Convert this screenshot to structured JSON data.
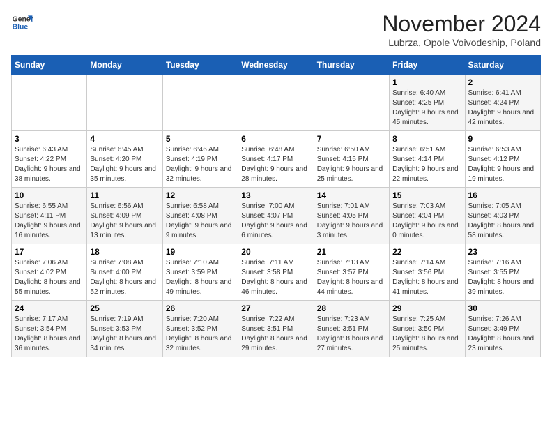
{
  "logo": {
    "general": "General",
    "blue": "Blue"
  },
  "title": "November 2024",
  "subtitle": "Lubrza, Opole Voivodeship, Poland",
  "weekdays": [
    "Sunday",
    "Monday",
    "Tuesday",
    "Wednesday",
    "Thursday",
    "Friday",
    "Saturday"
  ],
  "weeks": [
    [
      {
        "day": "",
        "info": ""
      },
      {
        "day": "",
        "info": ""
      },
      {
        "day": "",
        "info": ""
      },
      {
        "day": "",
        "info": ""
      },
      {
        "day": "",
        "info": ""
      },
      {
        "day": "1",
        "info": "Sunrise: 6:40 AM\nSunset: 4:25 PM\nDaylight: 9 hours and 45 minutes."
      },
      {
        "day": "2",
        "info": "Sunrise: 6:41 AM\nSunset: 4:24 PM\nDaylight: 9 hours and 42 minutes."
      }
    ],
    [
      {
        "day": "3",
        "info": "Sunrise: 6:43 AM\nSunset: 4:22 PM\nDaylight: 9 hours and 38 minutes."
      },
      {
        "day": "4",
        "info": "Sunrise: 6:45 AM\nSunset: 4:20 PM\nDaylight: 9 hours and 35 minutes."
      },
      {
        "day": "5",
        "info": "Sunrise: 6:46 AM\nSunset: 4:19 PM\nDaylight: 9 hours and 32 minutes."
      },
      {
        "day": "6",
        "info": "Sunrise: 6:48 AM\nSunset: 4:17 PM\nDaylight: 9 hours and 28 minutes."
      },
      {
        "day": "7",
        "info": "Sunrise: 6:50 AM\nSunset: 4:15 PM\nDaylight: 9 hours and 25 minutes."
      },
      {
        "day": "8",
        "info": "Sunrise: 6:51 AM\nSunset: 4:14 PM\nDaylight: 9 hours and 22 minutes."
      },
      {
        "day": "9",
        "info": "Sunrise: 6:53 AM\nSunset: 4:12 PM\nDaylight: 9 hours and 19 minutes."
      }
    ],
    [
      {
        "day": "10",
        "info": "Sunrise: 6:55 AM\nSunset: 4:11 PM\nDaylight: 9 hours and 16 minutes."
      },
      {
        "day": "11",
        "info": "Sunrise: 6:56 AM\nSunset: 4:09 PM\nDaylight: 9 hours and 13 minutes."
      },
      {
        "day": "12",
        "info": "Sunrise: 6:58 AM\nSunset: 4:08 PM\nDaylight: 9 hours and 9 minutes."
      },
      {
        "day": "13",
        "info": "Sunrise: 7:00 AM\nSunset: 4:07 PM\nDaylight: 9 hours and 6 minutes."
      },
      {
        "day": "14",
        "info": "Sunrise: 7:01 AM\nSunset: 4:05 PM\nDaylight: 9 hours and 3 minutes."
      },
      {
        "day": "15",
        "info": "Sunrise: 7:03 AM\nSunset: 4:04 PM\nDaylight: 9 hours and 0 minutes."
      },
      {
        "day": "16",
        "info": "Sunrise: 7:05 AM\nSunset: 4:03 PM\nDaylight: 8 hours and 58 minutes."
      }
    ],
    [
      {
        "day": "17",
        "info": "Sunrise: 7:06 AM\nSunset: 4:02 PM\nDaylight: 8 hours and 55 minutes."
      },
      {
        "day": "18",
        "info": "Sunrise: 7:08 AM\nSunset: 4:00 PM\nDaylight: 8 hours and 52 minutes."
      },
      {
        "day": "19",
        "info": "Sunrise: 7:10 AM\nSunset: 3:59 PM\nDaylight: 8 hours and 49 minutes."
      },
      {
        "day": "20",
        "info": "Sunrise: 7:11 AM\nSunset: 3:58 PM\nDaylight: 8 hours and 46 minutes."
      },
      {
        "day": "21",
        "info": "Sunrise: 7:13 AM\nSunset: 3:57 PM\nDaylight: 8 hours and 44 minutes."
      },
      {
        "day": "22",
        "info": "Sunrise: 7:14 AM\nSunset: 3:56 PM\nDaylight: 8 hours and 41 minutes."
      },
      {
        "day": "23",
        "info": "Sunrise: 7:16 AM\nSunset: 3:55 PM\nDaylight: 8 hours and 39 minutes."
      }
    ],
    [
      {
        "day": "24",
        "info": "Sunrise: 7:17 AM\nSunset: 3:54 PM\nDaylight: 8 hours and 36 minutes."
      },
      {
        "day": "25",
        "info": "Sunrise: 7:19 AM\nSunset: 3:53 PM\nDaylight: 8 hours and 34 minutes."
      },
      {
        "day": "26",
        "info": "Sunrise: 7:20 AM\nSunset: 3:52 PM\nDaylight: 8 hours and 32 minutes."
      },
      {
        "day": "27",
        "info": "Sunrise: 7:22 AM\nSunset: 3:51 PM\nDaylight: 8 hours and 29 minutes."
      },
      {
        "day": "28",
        "info": "Sunrise: 7:23 AM\nSunset: 3:51 PM\nDaylight: 8 hours and 27 minutes."
      },
      {
        "day": "29",
        "info": "Sunrise: 7:25 AM\nSunset: 3:50 PM\nDaylight: 8 hours and 25 minutes."
      },
      {
        "day": "30",
        "info": "Sunrise: 7:26 AM\nSunset: 3:49 PM\nDaylight: 8 hours and 23 minutes."
      }
    ]
  ]
}
